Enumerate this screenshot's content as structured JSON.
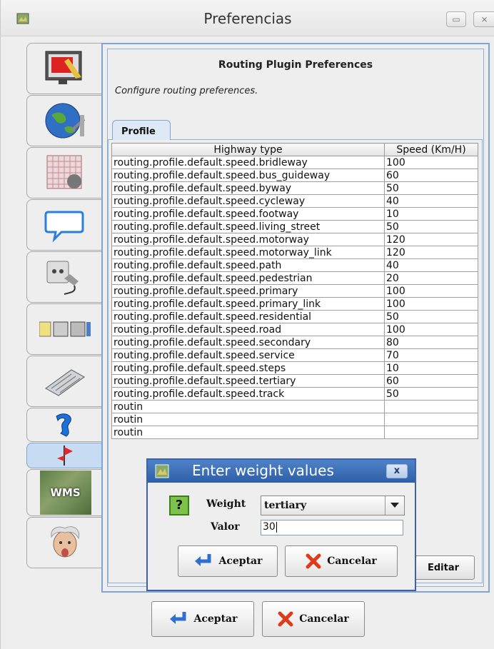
{
  "window": {
    "title": "Preferencias"
  },
  "plugin": {
    "heading": "Routing Plugin Preferences",
    "subtitle": "Configure routing preferences.",
    "tab": "Profile"
  },
  "table": {
    "columns": [
      "Highway type",
      "Speed (Km/H)"
    ],
    "rows": [
      [
        "routing.profile.default.speed.bridleway",
        "100"
      ],
      [
        "routing.profile.default.speed.bus_guideway",
        "60"
      ],
      [
        "routing.profile.default.speed.byway",
        "50"
      ],
      [
        "routing.profile.default.speed.cycleway",
        "40"
      ],
      [
        "routing.profile.default.speed.footway",
        "10"
      ],
      [
        "routing.profile.default.speed.living_street",
        "50"
      ],
      [
        "routing.profile.default.speed.motorway",
        "120"
      ],
      [
        "routing.profile.default.speed.motorway_link",
        "120"
      ],
      [
        "routing.profile.default.speed.path",
        "40"
      ],
      [
        "routing.profile.default.speed.pedestrian",
        "20"
      ],
      [
        "routing.profile.default.speed.primary",
        "100"
      ],
      [
        "routing.profile.default.speed.primary_link",
        "100"
      ],
      [
        "routing.profile.default.speed.residential",
        "50"
      ],
      [
        "routing.profile.default.speed.road",
        "100"
      ],
      [
        "routing.profile.default.speed.secondary",
        "80"
      ],
      [
        "routing.profile.default.speed.service",
        "70"
      ],
      [
        "routing.profile.default.speed.steps",
        "10"
      ],
      [
        "routing.profile.default.speed.tertiary",
        "60"
      ],
      [
        "routing.profile.default.speed.track",
        "50"
      ],
      [
        "routin",
        ""
      ],
      [
        "routin",
        ""
      ],
      [
        "routin",
        ""
      ]
    ]
  },
  "edit_label": "Editar",
  "footer": {
    "ok_label": "Aceptar",
    "cancel_label": "Cancelar"
  },
  "dialog": {
    "title": "Enter weight values",
    "close": "x",
    "icon_text": "?",
    "weight_label": "Weight",
    "weight_value": "tertiary",
    "valor_label": "Valor",
    "valor_value": "30",
    "ok_label": "Aceptar",
    "cancel_label": "Cancelar"
  },
  "sidebar_tabs": [
    "display-icon",
    "globe-icon",
    "grid-map-icon",
    "speech-bubble-icon",
    "plug-icon",
    "toolbar-icon",
    "keyboard-icon",
    "remote-control-icon",
    "routing-flag-icon",
    "wms-icon",
    "einstein-icon"
  ],
  "sidebar_wms_text": "WMS",
  "colors": {
    "accent": "#3e62a8",
    "panel_border": "#7ea6d0",
    "active_tab": "#c7dcf2",
    "ok_arrow": "#2f6fd1",
    "cancel_x": "#e03a1a"
  }
}
